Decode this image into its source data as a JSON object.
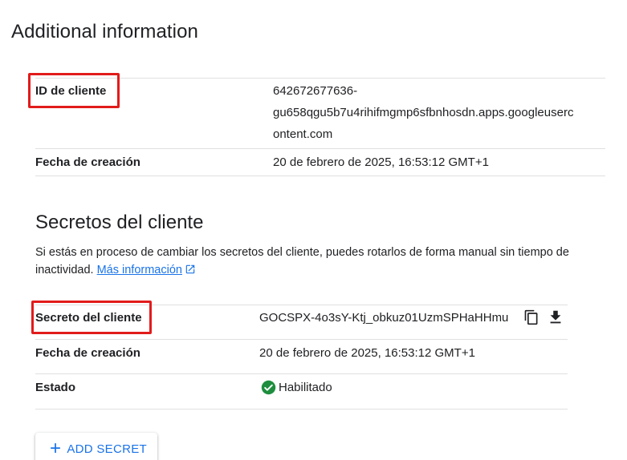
{
  "page": {
    "title": "Additional information"
  },
  "client_info": {
    "id_label": "ID de cliente",
    "id_value_lines": [
      "642672677636-",
      "gu658qgu5b7u4rihifmgmp6sfbnhosdn.apps.googleuserc",
      "ontent.com"
    ],
    "created_label": "Fecha de creación",
    "created_value": "20 de febrero de 2025, 16:53:12 GMT+1"
  },
  "secrets": {
    "title": "Secretos del cliente",
    "description": "Si estás en proceso de cambiar los secretos del cliente, puedes rotarlos de forma manual sin tiempo de inactividad.",
    "learn_more": "Más información",
    "secret_label": "Secreto del cliente",
    "secret_value": "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",
    "created_label": "Fecha de creación",
    "created_value": "20 de febrero de 2025, 16:53:12 GMT+1",
    "status_label": "Estado",
    "status_value": "Habilitado",
    "add_button": "ADD SECRET"
  },
  "icons": {
    "copy": "copy-icon",
    "download": "download-icon",
    "status": "check-circle-icon",
    "external": "open-in-new-icon",
    "add": "plus-icon"
  },
  "colors": {
    "highlight": "#e21b1b",
    "link": "#1a73e8",
    "success": "#1e8e3e",
    "divider": "#e0e0e0"
  }
}
